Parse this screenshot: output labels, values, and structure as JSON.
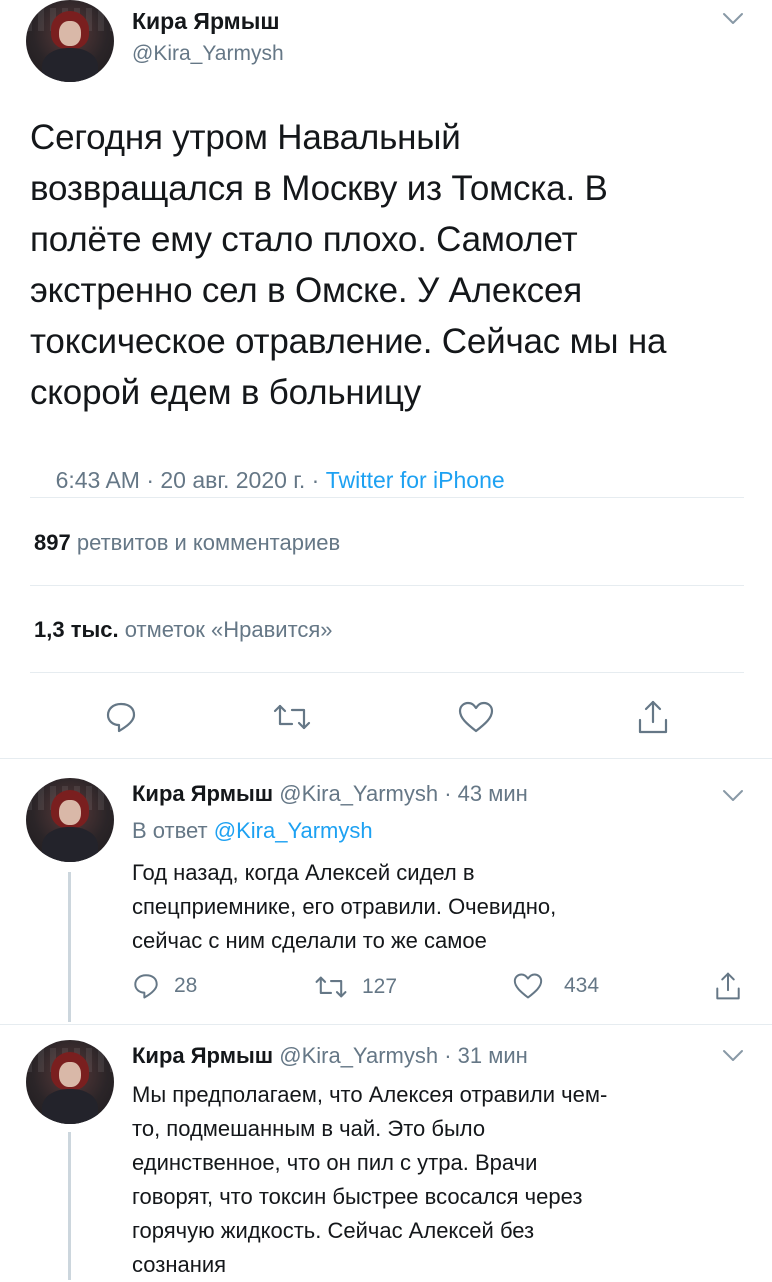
{
  "main_tweet": {
    "author_name": "Кира Ярмыш",
    "author_handle": "@Kira_Yarmysh",
    "text_lines": [
      "Сегодня утром Навальный",
      "возвращался в Москву из Томска. В",
      "полёте ему стало плохо. Самолет",
      "экстренно сел в Омске. У Алексея",
      "токсическое отравление. Сейчас мы на",
      "скорой едем в больницу"
    ],
    "meta_time": "6:43 AM · 20 авг. 2020 г. · ",
    "meta_source": "Twitter for iPhone",
    "retweets_count": "897",
    "retweets_label": "ретвитов и комментариев",
    "likes_count": "1,3 тыс.",
    "likes_label": "отметок «Нравится»"
  },
  "replies": [
    {
      "author_name": "Кира Ярмыш",
      "author_handle": "@Kira_Yarmysh · 43 мин",
      "reply_to_prefix": "В ответ ",
      "reply_to_handle": "@Kira_Yarmysh",
      "text_lines": [
        "Год назад, когда Алексей сидел в",
        "спецприемнике, его отравили. Очевидно,",
        "сейчас с ним сделали то же самое"
      ],
      "reply_count": "28",
      "retweet_count": "127",
      "like_count": "434"
    },
    {
      "author_name": "Кира Ярмыш",
      "author_handle": "@Kira_Yarmysh · 31 мин",
      "text_lines": [
        "Мы предполагаем, что Алексея отравили чем-",
        "то, подмешанным в чай. Это было",
        "единственное, что он пил с утра. Врачи",
        "говорят, что токсин быстрее всосался через",
        "горячую жидкость. Сейчас Алексей без",
        "сознания"
      ]
    }
  ],
  "icons": {
    "reply": "reply-icon",
    "retweet": "retweet-icon",
    "like": "heart-icon",
    "share": "share-icon",
    "more": "chevron-down-icon"
  },
  "colors": {
    "link": "#1da1f2",
    "muted": "#657786",
    "divider": "#e6ecf0"
  }
}
